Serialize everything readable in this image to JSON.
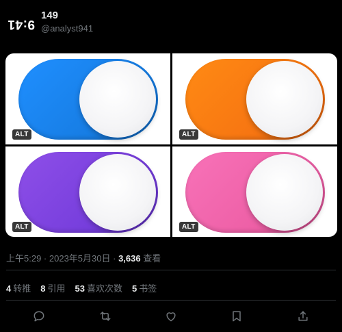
{
  "header": {
    "avatar_text": "9:41",
    "display_name": "149",
    "handle": "@analyst941"
  },
  "media": {
    "images": [
      {
        "color_name": "blue",
        "alt_badge": "ALT",
        "colors": [
          "#1f8fff",
          "#1374d6"
        ]
      },
      {
        "color_name": "orange",
        "alt_badge": "ALT",
        "colors": [
          "#ff8a14",
          "#f26a10"
        ]
      },
      {
        "color_name": "purple",
        "alt_badge": "ALT",
        "colors": [
          "#8e4fe8",
          "#6a35d6"
        ]
      },
      {
        "color_name": "pink",
        "alt_badge": "ALT",
        "colors": [
          "#f872b8",
          "#e8569d"
        ]
      }
    ]
  },
  "meta": {
    "time": "上午5:29",
    "separator1": " · ",
    "date": "2023年5月30日",
    "separator2": " · ",
    "views_count": "3,636",
    "views_label": " 查看"
  },
  "stats": [
    {
      "count": "4",
      "label": "转推"
    },
    {
      "count": "8",
      "label": "引用"
    },
    {
      "count": "53",
      "label": "喜欢次数"
    },
    {
      "count": "5",
      "label": "书签"
    }
  ],
  "actions": {
    "icons": [
      "reply-icon",
      "retweet-icon",
      "like-icon",
      "bookmark-icon",
      "share-icon"
    ]
  },
  "colors": {
    "background": "#000000",
    "text_primary": "#e7e9ea",
    "text_secondary": "#71767b",
    "divider": "#2f3336"
  }
}
